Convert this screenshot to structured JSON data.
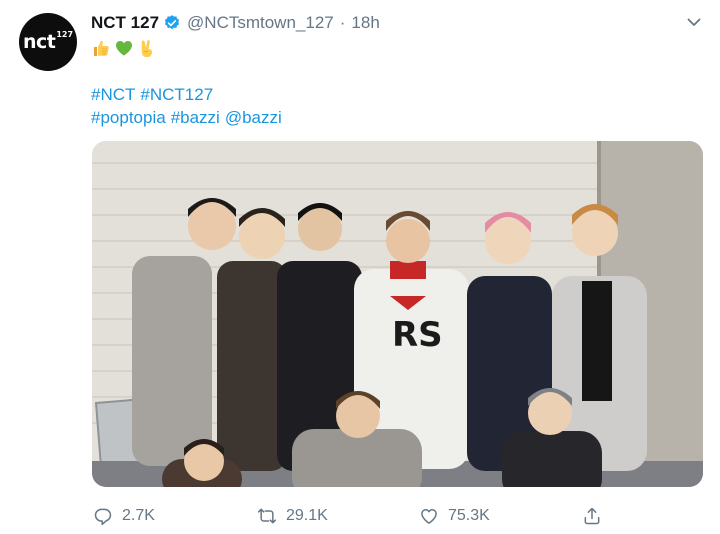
{
  "tweet": {
    "avatar_text": "nct",
    "avatar_sup": "127",
    "display_name": "NCT 127",
    "handle": "@NCTsmtown_127",
    "separator": "·",
    "time": "18h",
    "emojis": [
      "thumbs-up-emoji",
      "green-heart-emoji",
      "victory-hand-emoji"
    ],
    "hashtags_line1": [
      "#NCT",
      "#NCT127"
    ],
    "hashtags_line2": [
      "#poptopia",
      "#bazzi",
      "@bazzi"
    ]
  },
  "actions": {
    "reply_count": "2.7K",
    "retweet_count": "29.1K",
    "like_count": "75.3K"
  },
  "colors": {
    "link": "#1b95e0",
    "verified": "#1da1f2",
    "muted": "#657786"
  }
}
